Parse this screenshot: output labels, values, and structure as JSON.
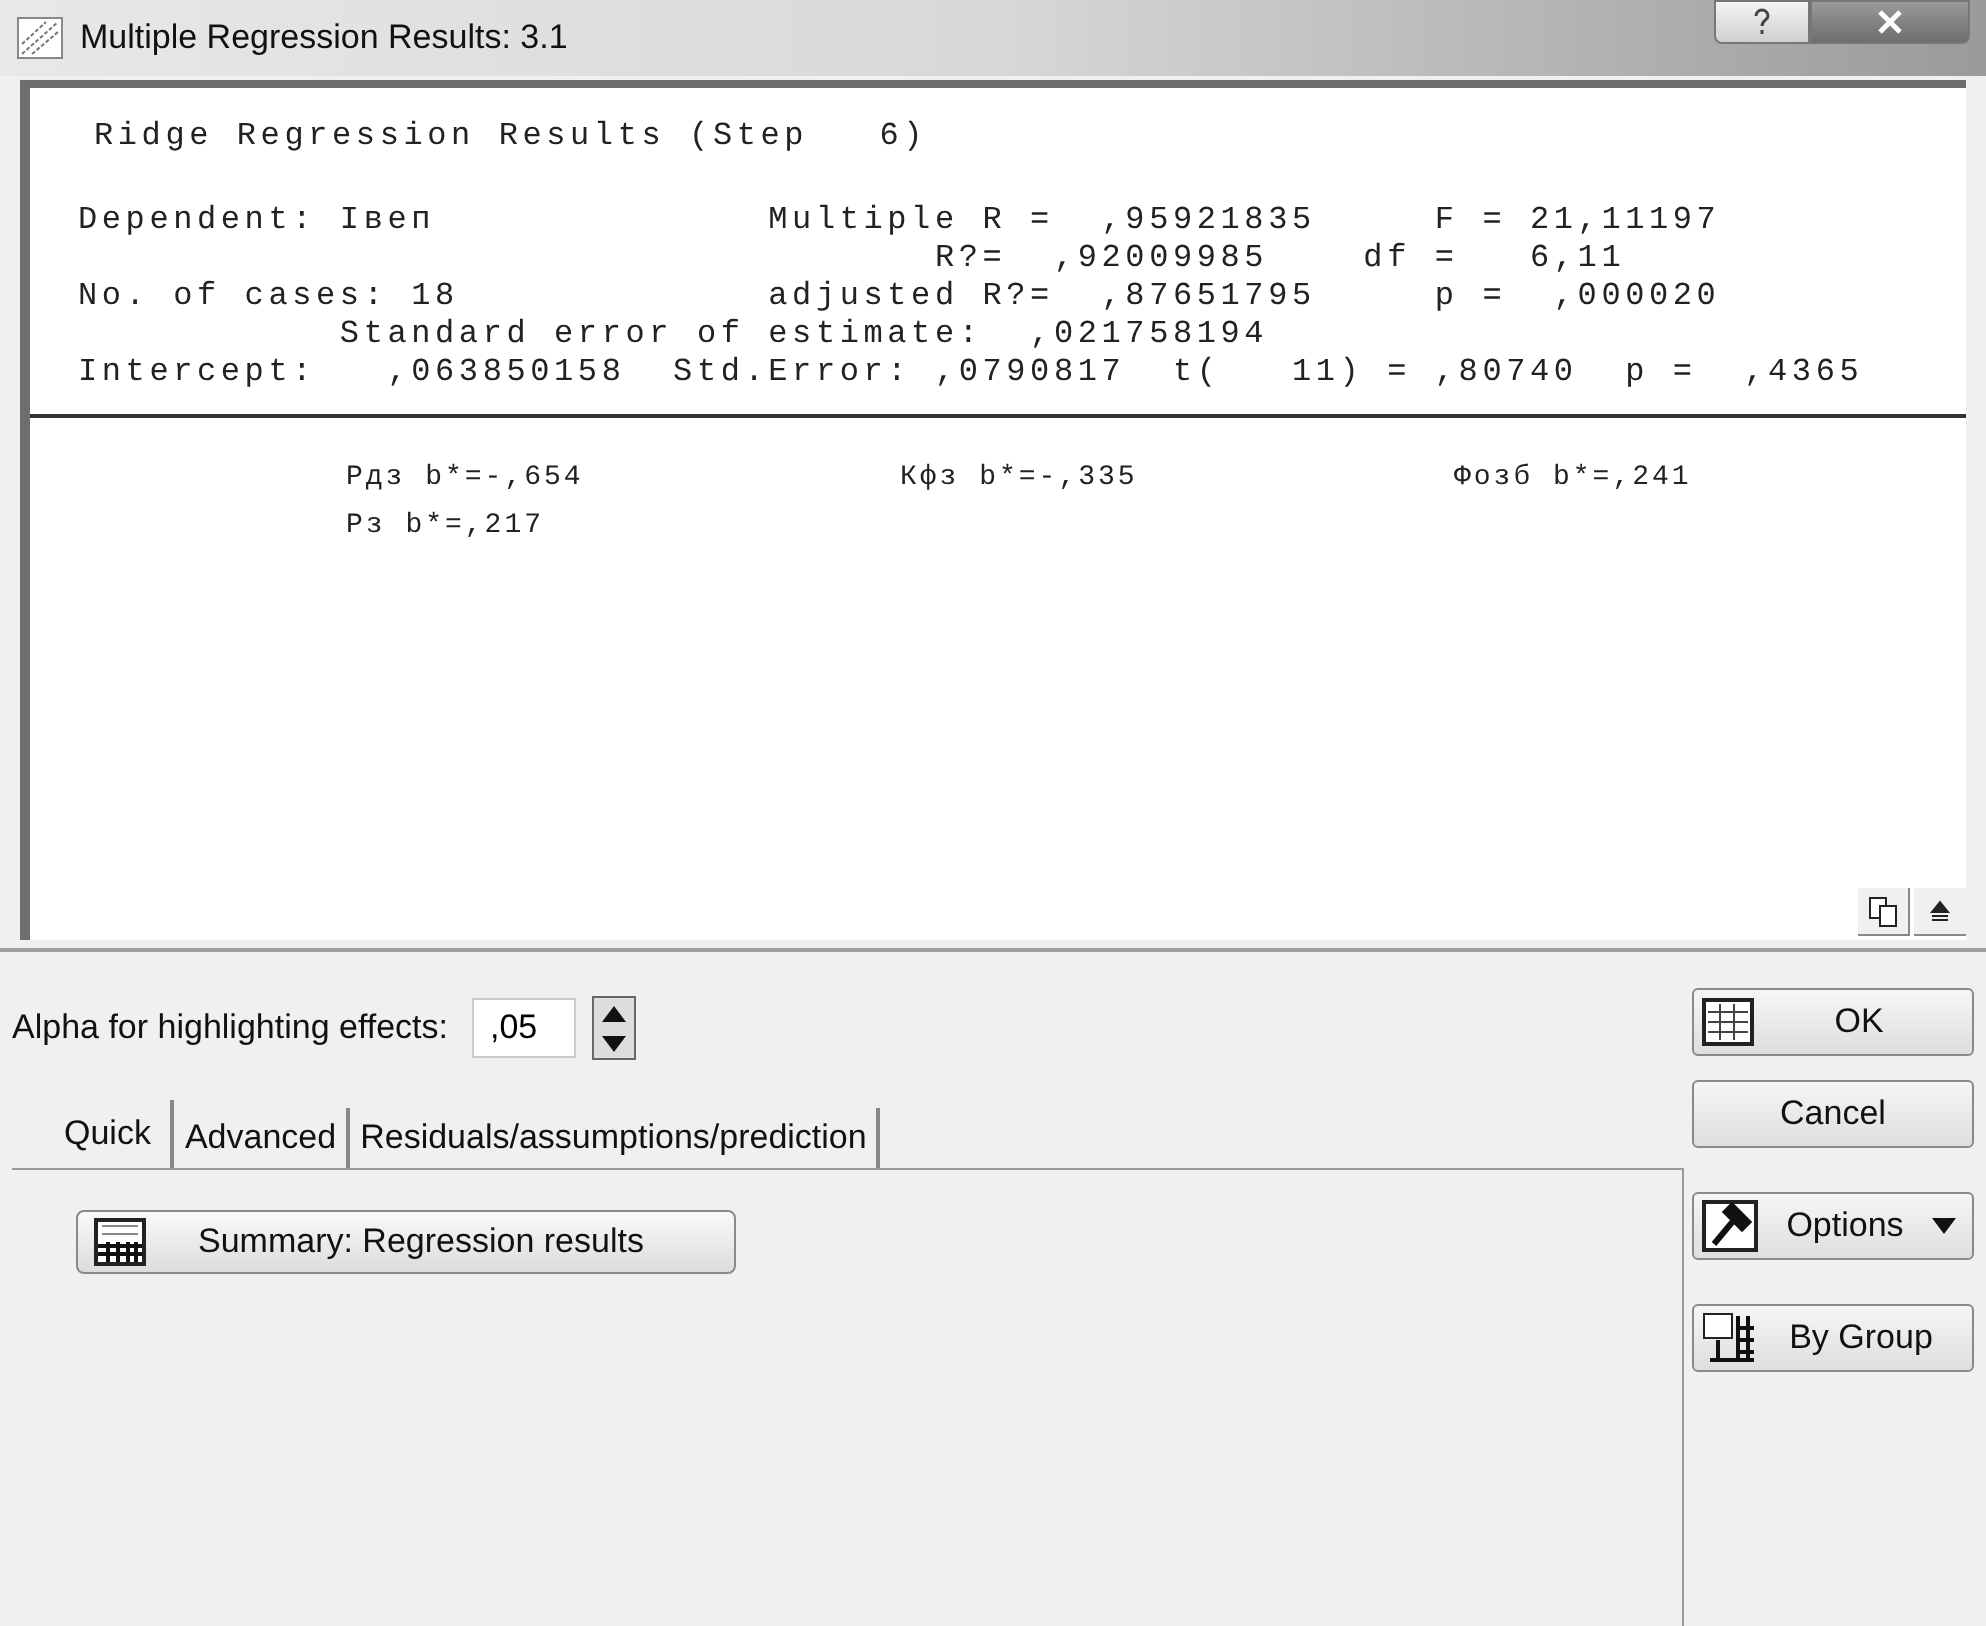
{
  "window": {
    "title": "Multiple Regression Results: 3.1"
  },
  "report": {
    "heading": "Ridge Regression Results (Step   6)",
    "lines": [
      "Dependent: Iвеп              Multiple R =  ,95921835     F = 21,11197",
      "                                    R?=  ,92009985    df =   6,11",
      "No. of cases: 18             adjusted R?=  ,87651795     p =  ,000020",
      "           Standard error of estimate:  ,021758194",
      "Intercept:   ,063850158  Std.Error: ,0790817  t(   11) = ,80740  p =  ,4365"
    ]
  },
  "coefficients": [
    "Рдз b*=-,654",
    "Кфз b*=-,335",
    "Фозб b*=,241",
    "Рз b*=,217"
  ],
  "alpha": {
    "label": "Alpha for highlighting effects:",
    "value": ",05"
  },
  "tabs": [
    {
      "label": "Quick",
      "selected": true
    },
    {
      "label": "Advanced",
      "selected": false
    },
    {
      "label": "Residuals/assumptions/prediction",
      "selected": false
    }
  ],
  "summary_button": "Summary:  Regression results",
  "buttons": [
    {
      "kind": "ok",
      "label": "OK"
    },
    {
      "kind": "cancel",
      "label": "Cancel"
    },
    {
      "kind": "options",
      "label": "Options"
    },
    {
      "kind": "bygroup",
      "label": "By Group"
    }
  ]
}
